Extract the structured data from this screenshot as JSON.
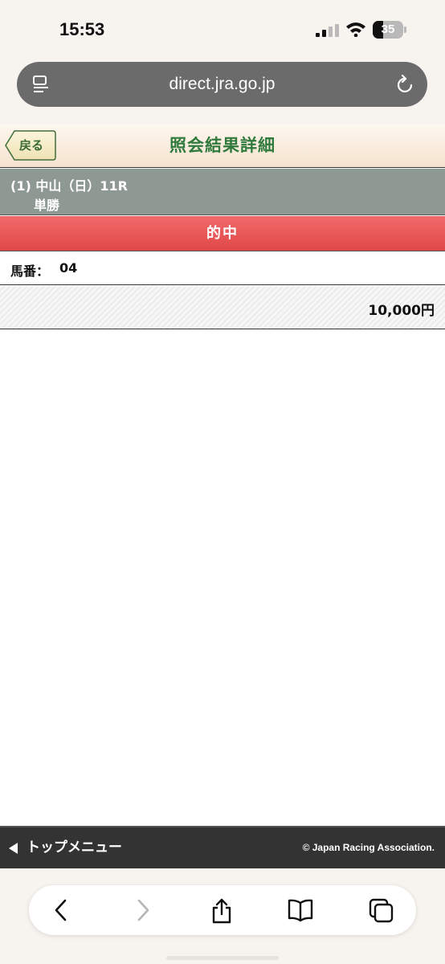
{
  "status_bar": {
    "time": "15:53",
    "battery_level": "35",
    "battery_fraction": 0.35
  },
  "browser": {
    "url": "direct.jra.go.jp"
  },
  "header": {
    "back_label": "戻る",
    "title": "照会結果詳細"
  },
  "race": {
    "line1": "(1) 中山（日）11R",
    "line2": "単勝"
  },
  "result": {
    "status": "的中"
  },
  "horse": {
    "label": "馬番：",
    "number": "04"
  },
  "amount": {
    "value": "10,000円"
  },
  "footer": {
    "top_menu_label": "トップメニュー",
    "copyright": "© Japan Racing Association."
  },
  "toolbar": {
    "icons": [
      "back-icon",
      "forward-icon",
      "share-icon",
      "bookmarks-icon",
      "tabs-icon"
    ]
  },
  "colors": {
    "header_title": "#2f7a3c",
    "race_bar": "#8f9994",
    "result_banner": "#e85555",
    "footer_bg": "#333333",
    "url_bar": "#6b6b6b"
  }
}
